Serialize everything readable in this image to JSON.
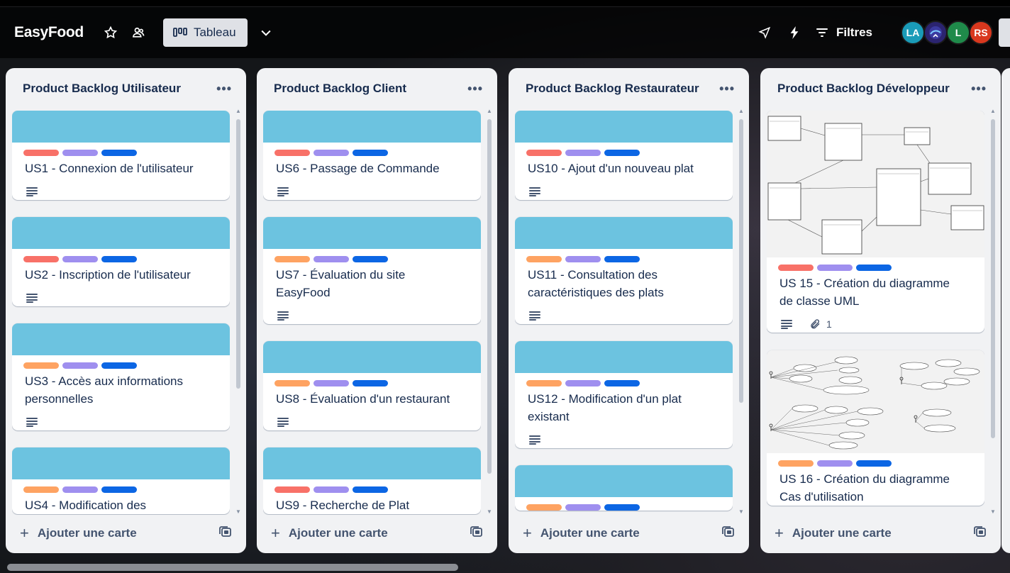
{
  "header": {
    "board_title": "EasyFood",
    "view_label": "Tableau",
    "filters_label": "Filtres",
    "avatars": [
      {
        "initials": "LA",
        "color": "#1a9bb8"
      },
      {
        "initials": "",
        "color": "#2b2470"
      },
      {
        "initials": "L",
        "color": "#1f8a4a"
      },
      {
        "initials": "RS",
        "color": "#d9381e"
      }
    ]
  },
  "colors": {
    "label_red": "#f87168",
    "label_orange": "#fea362",
    "label_purple": "#9f8fef",
    "label_blue": "#0c66e4",
    "card_cover": "#6cc3e0"
  },
  "add_card_label": "Ajouter une carte",
  "lists": [
    {
      "title": "Product Backlog Utilisateur",
      "cards": [
        {
          "title": "US1 - Connexion de l'utilisateur",
          "first_label": "red"
        },
        {
          "title": "US2 - Inscription de l'utilisateur",
          "first_label": "red"
        },
        {
          "title": "US3 - Accès aux informations personnelles",
          "first_label": "orange"
        },
        {
          "title": "US4 - Modification des",
          "first_label": "orange"
        }
      ]
    },
    {
      "title": "Product Backlog Client",
      "cards": [
        {
          "title": "US6 - Passage de Commande",
          "first_label": "red"
        },
        {
          "title": "US7 - Évaluation du site EasyFood",
          "first_label": "orange"
        },
        {
          "title": "US8 - Évaluation d'un restaurant",
          "first_label": "orange"
        },
        {
          "title": "US9 - Recherche de Plat",
          "first_label": "red"
        }
      ]
    },
    {
      "title": "Product Backlog Restaurateur",
      "cards": [
        {
          "title": "US10 - Ajout d'un nouveau plat",
          "first_label": "red"
        },
        {
          "title": "US11 - Consultation des caractéristiques des plats",
          "first_label": "orange"
        },
        {
          "title": "US12 - Modification d'un plat existant",
          "first_label": "orange"
        },
        {
          "title": "",
          "first_label": "orange"
        }
      ]
    },
    {
      "title": "Product Backlog Développeur",
      "cards": [
        {
          "title": "US 15 - Création du diagramme de classe UML",
          "first_label": "red",
          "attachments": "1"
        },
        {
          "title": "US 16 - Création du diagramme Cas d'utilisation",
          "first_label": "orange"
        }
      ]
    }
  ]
}
